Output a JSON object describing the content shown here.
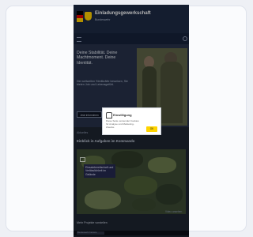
{
  "banner": {
    "title": "Einladungsgewerkschaft",
    "subtitle": "Bundeswehr"
  },
  "hero": {
    "headline": "Deine Stabilität. Deine Machtmoment. Deine Identität.",
    "description": "Die weltweiten Streitkräfte beweisen, Sie bieten Job und Lebensgefühl.",
    "button": "Jetzt informieren"
  },
  "news": {
    "label": "Aktuelles",
    "title": "Einblick in Aufgaben im Kommando"
  },
  "media": {
    "overlay_text": "Einsatzbereitschaft und Verlässlichkeit im Gelände",
    "caption": "Video ansehen",
    "bottom_title": "Mehr Projekte vorstellen",
    "bottom_chip": "Bundeswehr Karriere"
  },
  "dialog": {
    "title": "Einwilligung",
    "text": "Diese Seite verwendet Cookies für Analyse und Marketing-Zwecke.",
    "button": "OK"
  },
  "colors": {
    "banner": "#1d2a44",
    "accent": "#ffd400",
    "camo": "#3b4a33"
  }
}
